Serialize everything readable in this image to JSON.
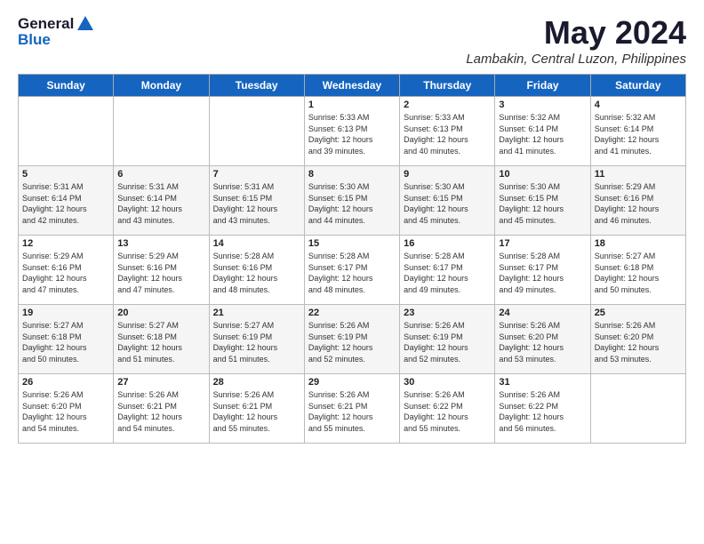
{
  "logo": {
    "line1": "General",
    "line2": "Blue"
  },
  "title": "May 2024",
  "subtitle": "Lambakin, Central Luzon, Philippines",
  "headers": [
    "Sunday",
    "Monday",
    "Tuesday",
    "Wednesday",
    "Thursday",
    "Friday",
    "Saturday"
  ],
  "weeks": [
    [
      {
        "day": "",
        "info": ""
      },
      {
        "day": "",
        "info": ""
      },
      {
        "day": "",
        "info": ""
      },
      {
        "day": "1",
        "info": "Sunrise: 5:33 AM\nSunset: 6:13 PM\nDaylight: 12 hours\nand 39 minutes."
      },
      {
        "day": "2",
        "info": "Sunrise: 5:33 AM\nSunset: 6:13 PM\nDaylight: 12 hours\nand 40 minutes."
      },
      {
        "day": "3",
        "info": "Sunrise: 5:32 AM\nSunset: 6:14 PM\nDaylight: 12 hours\nand 41 minutes."
      },
      {
        "day": "4",
        "info": "Sunrise: 5:32 AM\nSunset: 6:14 PM\nDaylight: 12 hours\nand 41 minutes."
      }
    ],
    [
      {
        "day": "5",
        "info": "Sunrise: 5:31 AM\nSunset: 6:14 PM\nDaylight: 12 hours\nand 42 minutes."
      },
      {
        "day": "6",
        "info": "Sunrise: 5:31 AM\nSunset: 6:14 PM\nDaylight: 12 hours\nand 43 minutes."
      },
      {
        "day": "7",
        "info": "Sunrise: 5:31 AM\nSunset: 6:15 PM\nDaylight: 12 hours\nand 43 minutes."
      },
      {
        "day": "8",
        "info": "Sunrise: 5:30 AM\nSunset: 6:15 PM\nDaylight: 12 hours\nand 44 minutes."
      },
      {
        "day": "9",
        "info": "Sunrise: 5:30 AM\nSunset: 6:15 PM\nDaylight: 12 hours\nand 45 minutes."
      },
      {
        "day": "10",
        "info": "Sunrise: 5:30 AM\nSunset: 6:15 PM\nDaylight: 12 hours\nand 45 minutes."
      },
      {
        "day": "11",
        "info": "Sunrise: 5:29 AM\nSunset: 6:16 PM\nDaylight: 12 hours\nand 46 minutes."
      }
    ],
    [
      {
        "day": "12",
        "info": "Sunrise: 5:29 AM\nSunset: 6:16 PM\nDaylight: 12 hours\nand 47 minutes."
      },
      {
        "day": "13",
        "info": "Sunrise: 5:29 AM\nSunset: 6:16 PM\nDaylight: 12 hours\nand 47 minutes."
      },
      {
        "day": "14",
        "info": "Sunrise: 5:28 AM\nSunset: 6:16 PM\nDaylight: 12 hours\nand 48 minutes."
      },
      {
        "day": "15",
        "info": "Sunrise: 5:28 AM\nSunset: 6:17 PM\nDaylight: 12 hours\nand 48 minutes."
      },
      {
        "day": "16",
        "info": "Sunrise: 5:28 AM\nSunset: 6:17 PM\nDaylight: 12 hours\nand 49 minutes."
      },
      {
        "day": "17",
        "info": "Sunrise: 5:28 AM\nSunset: 6:17 PM\nDaylight: 12 hours\nand 49 minutes."
      },
      {
        "day": "18",
        "info": "Sunrise: 5:27 AM\nSunset: 6:18 PM\nDaylight: 12 hours\nand 50 minutes."
      }
    ],
    [
      {
        "day": "19",
        "info": "Sunrise: 5:27 AM\nSunset: 6:18 PM\nDaylight: 12 hours\nand 50 minutes."
      },
      {
        "day": "20",
        "info": "Sunrise: 5:27 AM\nSunset: 6:18 PM\nDaylight: 12 hours\nand 51 minutes."
      },
      {
        "day": "21",
        "info": "Sunrise: 5:27 AM\nSunset: 6:19 PM\nDaylight: 12 hours\nand 51 minutes."
      },
      {
        "day": "22",
        "info": "Sunrise: 5:26 AM\nSunset: 6:19 PM\nDaylight: 12 hours\nand 52 minutes."
      },
      {
        "day": "23",
        "info": "Sunrise: 5:26 AM\nSunset: 6:19 PM\nDaylight: 12 hours\nand 52 minutes."
      },
      {
        "day": "24",
        "info": "Sunrise: 5:26 AM\nSunset: 6:20 PM\nDaylight: 12 hours\nand 53 minutes."
      },
      {
        "day": "25",
        "info": "Sunrise: 5:26 AM\nSunset: 6:20 PM\nDaylight: 12 hours\nand 53 minutes."
      }
    ],
    [
      {
        "day": "26",
        "info": "Sunrise: 5:26 AM\nSunset: 6:20 PM\nDaylight: 12 hours\nand 54 minutes."
      },
      {
        "day": "27",
        "info": "Sunrise: 5:26 AM\nSunset: 6:21 PM\nDaylight: 12 hours\nand 54 minutes."
      },
      {
        "day": "28",
        "info": "Sunrise: 5:26 AM\nSunset: 6:21 PM\nDaylight: 12 hours\nand 55 minutes."
      },
      {
        "day": "29",
        "info": "Sunrise: 5:26 AM\nSunset: 6:21 PM\nDaylight: 12 hours\nand 55 minutes."
      },
      {
        "day": "30",
        "info": "Sunrise: 5:26 AM\nSunset: 6:22 PM\nDaylight: 12 hours\nand 55 minutes."
      },
      {
        "day": "31",
        "info": "Sunrise: 5:26 AM\nSunset: 6:22 PM\nDaylight: 12 hours\nand 56 minutes."
      },
      {
        "day": "",
        "info": ""
      }
    ]
  ]
}
